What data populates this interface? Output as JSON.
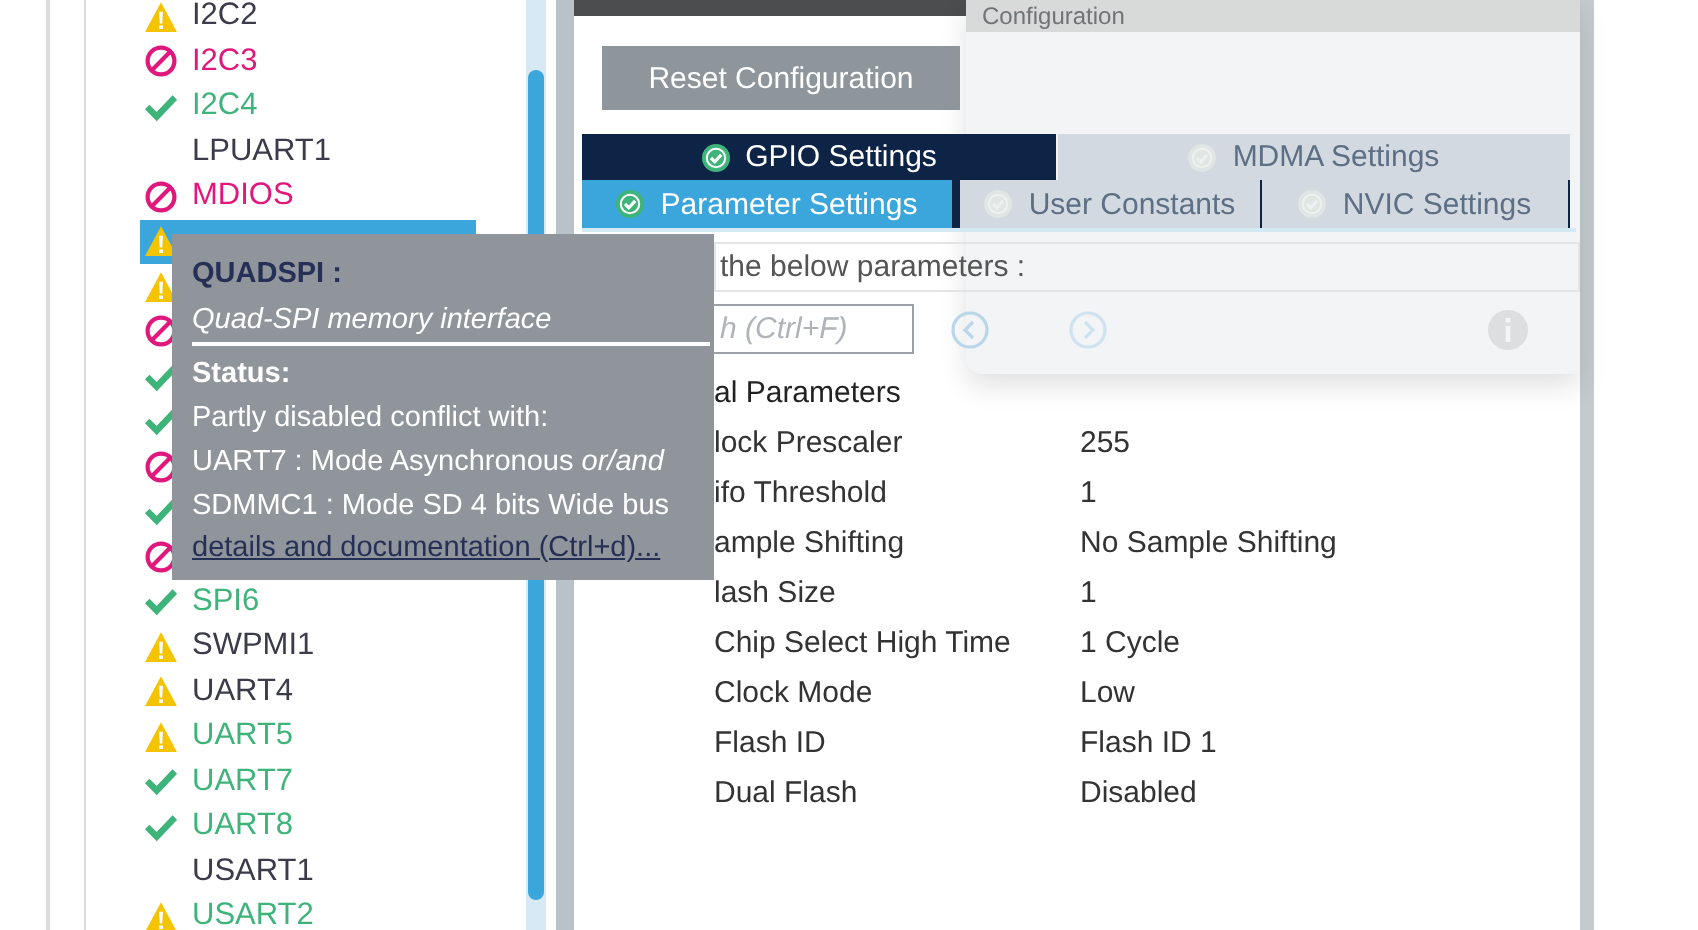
{
  "peripherals": [
    {
      "name": "I2C2",
      "kind": "warning",
      "color": "#3b3b4a",
      "selected": false
    },
    {
      "name": "I2C3",
      "kind": "blocked",
      "color": "#e0187c",
      "selected": false
    },
    {
      "name": "I2C4",
      "kind": "ok",
      "color": "#3fb47a",
      "selected": false
    },
    {
      "name": "LPUART1",
      "kind": "none",
      "color": "#3b3b4a",
      "selected": false
    },
    {
      "name": "MDIOS",
      "kind": "blocked",
      "color": "#e0187c",
      "selected": false
    },
    {
      "kind": "warning",
      "selected": true
    },
    {
      "kind": "warning",
      "selected": false
    },
    {
      "kind": "blocked",
      "selected": false
    },
    {
      "kind": "ok",
      "selected": false
    },
    {
      "kind": "ok",
      "selected": false
    },
    {
      "kind": "blocked",
      "selected": false
    },
    {
      "kind": "ok",
      "selected": false
    },
    {
      "kind": "blocked",
      "selected": false
    },
    {
      "name": "SPI6",
      "kind": "ok",
      "color": "#3fb47a",
      "selected": false
    },
    {
      "name": "SWPMI1",
      "kind": "warning",
      "color": "#3b3b4a",
      "selected": false
    },
    {
      "name": "UART4",
      "kind": "warning",
      "color": "#3b3b4a",
      "selected": false
    },
    {
      "name": "UART5",
      "kind": "warning",
      "color": "#3fb47a",
      "selected": false
    },
    {
      "name": "UART7",
      "kind": "ok",
      "color": "#3fb47a",
      "selected": false
    },
    {
      "name": "UART8",
      "kind": "ok",
      "color": "#3fb47a",
      "selected": false
    },
    {
      "name": "USART1",
      "kind": "none",
      "color": "#3b3b4a",
      "selected": false
    },
    {
      "name": "USART2",
      "kind": "warning",
      "color": "#3fb47a",
      "selected": false
    }
  ],
  "reset_button": "Reset Configuration",
  "floating_panel": {
    "title": "Configuration"
  },
  "tab_rows": [
    [
      {
        "label": "GPIO Settings",
        "selected": false,
        "dimmed": false
      },
      {
        "label": "MDMA Settings",
        "selected": false,
        "dimmed": true
      }
    ],
    [
      {
        "label": "Parameter Settings",
        "selected": true,
        "dimmed": false
      },
      {
        "label": "User Constants",
        "selected": false,
        "dimmed": true
      },
      {
        "label": "NVIC Settings",
        "selected": false,
        "dimmed": true
      }
    ]
  ],
  "configure_label": "the below parameters :",
  "search": {
    "placeholder": "h (Ctrl+F)"
  },
  "parameters": {
    "group": "al Parameters",
    "rows": [
      {
        "name": "lock Prescaler",
        "value": "255"
      },
      {
        "name": "ifo Threshold",
        "value": "1"
      },
      {
        "name": "ample Shifting",
        "value": "No Sample Shifting"
      },
      {
        "name": "lash Size",
        "value": "1"
      },
      {
        "name": "Chip Select High Time",
        "value": "1 Cycle"
      },
      {
        "name": "Clock Mode",
        "value": "Low"
      },
      {
        "name": "Flash ID",
        "value": "Flash ID 1"
      },
      {
        "name": "Dual Flash",
        "value": "Disabled"
      }
    ]
  },
  "tooltip": {
    "title": "QUADSPI :",
    "description": "Quad-SPI memory interface",
    "status_label": "Status:",
    "lines": [
      "Partly disabled conflict with:",
      "UART7 : Mode Asynchronous *or/and*",
      "SDMMC1 : Mode SD 4 bits Wide bus"
    ],
    "link": "details and documentation (Ctrl+d)..."
  }
}
